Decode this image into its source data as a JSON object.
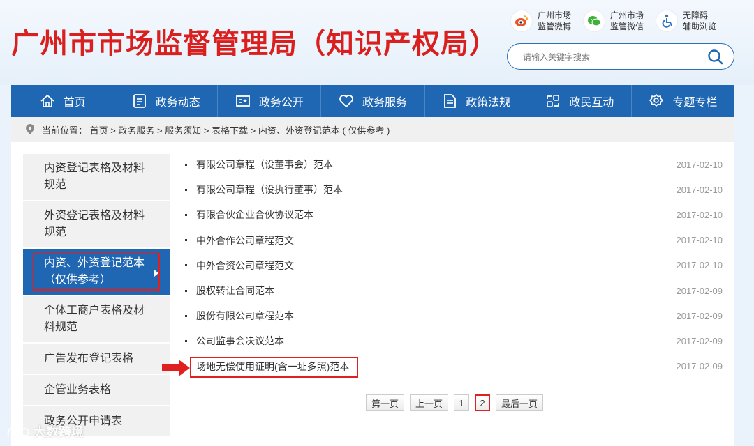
{
  "header": {
    "title": "广州市市场监督管理局（知识产权局）",
    "social": [
      {
        "icon": "weibo-icon",
        "line1": "广州市场",
        "line2": "监管微博",
        "color": "#e8532c"
      },
      {
        "icon": "wechat-icon",
        "line1": "广州市场",
        "line2": "监管微信",
        "color": "#3db23a"
      },
      {
        "icon": "accessibility-icon",
        "line1": "无障碍",
        "line2": "辅助浏览",
        "color": "#2f74c0"
      }
    ],
    "search_placeholder": "请输入关键字搜索"
  },
  "nav": {
    "items": [
      {
        "label": "首页",
        "icon": "home-icon"
      },
      {
        "label": "政务动态",
        "icon": "news-icon"
      },
      {
        "label": "政务公开",
        "icon": "open-gov-icon"
      },
      {
        "label": "政务服务",
        "icon": "heart-icon"
      },
      {
        "label": "政策法规",
        "icon": "document-icon"
      },
      {
        "label": "政民互动",
        "icon": "interaction-icon"
      },
      {
        "label": "专题专栏",
        "icon": "badge-icon"
      }
    ]
  },
  "breadcrumb": {
    "text": "当前位置： 首页 > 政务服务 > 服务须知 > 表格下载 > 内资、外资登记范本 ( 仅供参考 )"
  },
  "sidebar": {
    "items": [
      {
        "label": "内资登记表格及材料规范",
        "active": false
      },
      {
        "label": "外资登记表格及材料规范",
        "active": false
      },
      {
        "label": "内资、外资登记范本（仅供参考）",
        "active": true
      },
      {
        "label": "个体工商户表格及材料规范",
        "active": false
      },
      {
        "label": "广告发布登记表格",
        "active": false
      },
      {
        "label": "企管业务表格",
        "active": false
      },
      {
        "label": "政务公开申请表",
        "active": false
      }
    ]
  },
  "list": {
    "items": [
      {
        "title": "有限公司章程（设董事会）范本",
        "date": "2017-02-10"
      },
      {
        "title": "有限公司章程（设执行董事）范本",
        "date": "2017-02-10"
      },
      {
        "title": "有限合伙企业合伙协议范本",
        "date": "2017-02-10"
      },
      {
        "title": "中外合作公司章程范文",
        "date": "2017-02-10"
      },
      {
        "title": "中外合资公司章程范文",
        "date": "2017-02-10"
      },
      {
        "title": "股权转让合同范本",
        "date": "2017-02-09"
      },
      {
        "title": "股份有限公司章程范本",
        "date": "2017-02-09"
      },
      {
        "title": "公司监事会决议范本",
        "date": "2017-02-09"
      },
      {
        "title": "场地无偿使用证明(含一址多照)范本",
        "date": "2017-02-09"
      }
    ]
  },
  "pager": {
    "first": "第一页",
    "prev": "上一页",
    "pages": [
      "1",
      "2"
    ],
    "current": "2",
    "last": "最后一页"
  },
  "watermark": "大数跨境",
  "colors": {
    "brand_red": "#d9201e",
    "nav_blue": "#1f66b3",
    "highlight_red": "#e02020"
  }
}
